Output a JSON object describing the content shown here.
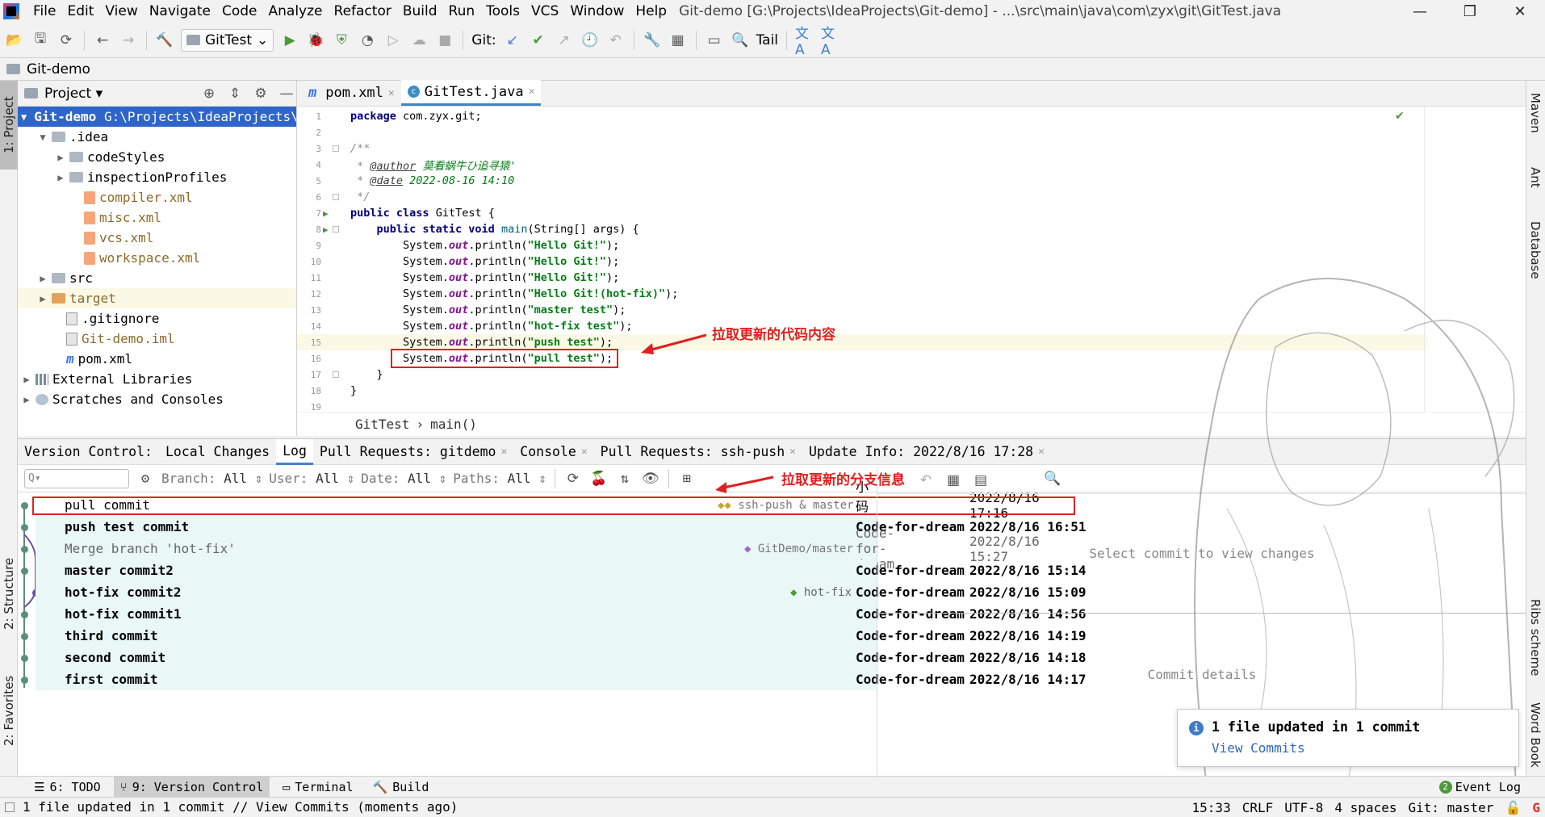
{
  "window": {
    "title": "Git-demo [G:\\Projects\\IdeaProjects\\Git-demo] - ...\\src\\main\\java\\com\\zyx\\git\\GitTest.java"
  },
  "menu": [
    "File",
    "Edit",
    "View",
    "Navigate",
    "Code",
    "Analyze",
    "Refactor",
    "Build",
    "Run",
    "Tools",
    "VCS",
    "Window",
    "Help"
  ],
  "toolbar": {
    "run_config": "GitTest",
    "git_label": "Git:",
    "tail_label": "Tail"
  },
  "navbar": {
    "project": "Git-demo"
  },
  "left_stripe": {
    "project": "1: Project",
    "structure": "2: Structure",
    "favorites": "2: Favorites"
  },
  "right_stripe": {
    "maven": "Maven",
    "ant": "Ant",
    "database": "Database",
    "ribs": "Ribs scheme",
    "wordbook": "Word Book"
  },
  "project_panel": {
    "title": "Project",
    "tree": [
      {
        "label": "Git-demo",
        "extra": "G:\\Projects\\IdeaProjects\\Git-demo"
      },
      {
        "label": ".idea"
      },
      {
        "label": "codeStyles"
      },
      {
        "label": "inspectionProfiles"
      },
      {
        "label": "compiler.xml"
      },
      {
        "label": "misc.xml"
      },
      {
        "label": "vcs.xml"
      },
      {
        "label": "workspace.xml"
      },
      {
        "label": "src"
      },
      {
        "label": "target"
      },
      {
        "label": ".gitignore"
      },
      {
        "label": "Git-demo.iml"
      },
      {
        "label": "pom.xml"
      },
      {
        "label": "External Libraries"
      },
      {
        "label": "Scratches and Consoles"
      }
    ]
  },
  "editor": {
    "tabs": [
      {
        "label": "pom.xml"
      },
      {
        "label": "GitTest.java"
      }
    ],
    "line_numbers": [
      "1",
      "2",
      "3",
      "4",
      "5",
      "6",
      "7",
      "8",
      "9",
      "10",
      "11",
      "12",
      "13",
      "14",
      "15",
      "16",
      "17",
      "18",
      "19"
    ],
    "package": "com.zyx.git;",
    "author_tag": "@author",
    "author_val": "莫看蜗牛ひ追寻猿'",
    "date_tag": "@date",
    "date_val": "2022-08-16 14:10",
    "class_name": "GitTest",
    "method": "main",
    "printlns": [
      "\"Hello Git!\"",
      "\"Hello Git!\"",
      "\"Hello Git!\"",
      "\"Hello Git!(hot-fix)\"",
      "\"master test\"",
      "\"hot-fix test\"",
      "\"push test\"",
      "\"pull test\""
    ],
    "breadcrumb": [
      "GitTest",
      "main()"
    ]
  },
  "annotations": {
    "code": "拉取更新的代码内容",
    "branch": "拉取更新的分支信息"
  },
  "vcs": {
    "label": "Version Control:",
    "tabs": [
      {
        "label": "Local Changes"
      },
      {
        "label": "Log"
      },
      {
        "label": "Pull Requests: gitdemo"
      },
      {
        "label": "Console"
      },
      {
        "label": "Pull Requests: ssh-push"
      },
      {
        "label": "Update Info: 2022/8/16 17:28"
      }
    ],
    "filters": {
      "branch": "Branch:",
      "branch_val": "All",
      "user": "User:",
      "user_val": "All",
      "date": "Date:",
      "date_val": "All",
      "paths": "Paths:",
      "paths_val": "All"
    },
    "search_placeholder": "Q▾",
    "commits": [
      {
        "msg": "pull commit",
        "ref": "ssh-push & master",
        "author": "小码虫*",
        "date": "2022/8/16 17:16"
      },
      {
        "msg": "push test commit",
        "ref": "",
        "author": "Code-for-dream",
        "date": "2022/8/16 16:51"
      },
      {
        "msg": "Merge branch 'hot-fix'",
        "ref": "GitDemo/master",
        "author": "Code-for-dream",
        "date": "2022/8/16 15:27"
      },
      {
        "msg": "master commit2",
        "ref": "",
        "author": "Code-for-dream",
        "date": "2022/8/16 15:14"
      },
      {
        "msg": "hot-fix commit2",
        "ref": "hot-fix",
        "author": "Code-for-dream",
        "date": "2022/8/16 15:09"
      },
      {
        "msg": "hot-fix commit1",
        "ref": "",
        "author": "Code-for-dream",
        "date": "2022/8/16 14:56"
      },
      {
        "msg": "third commit",
        "ref": "",
        "author": "Code-for-dream",
        "date": "2022/8/16 14:19"
      },
      {
        "msg": "second commit",
        "ref": "",
        "author": "Code-for-dream",
        "date": "2022/8/16 14:18"
      },
      {
        "msg": "first commit",
        "ref": "",
        "author": "Code-for-dream",
        "date": "2022/8/16 14:17"
      }
    ],
    "changes_placeholder": "Select commit to view changes",
    "details_placeholder": "Commit details"
  },
  "notification": {
    "title": "1 file updated in 1 commit",
    "link": "View Commits"
  },
  "bottom_tabs": [
    {
      "label": "6: TODO"
    },
    {
      "label": "9: Version Control"
    },
    {
      "label": "Terminal"
    },
    {
      "label": "Build"
    }
  ],
  "event_log": {
    "count": "2",
    "label": "Event Log"
  },
  "status": {
    "message": "1 file updated in 1 commit // View Commits (moments ago)",
    "position": "15:33",
    "line_sep": "CRLF",
    "encoding": "UTF-8",
    "indent": "4 spaces",
    "branch": "Git: master"
  },
  "colors": {
    "accent": "#2f65ca",
    "annotation": "#e02020",
    "commit_bg": "#e9f7f7"
  }
}
